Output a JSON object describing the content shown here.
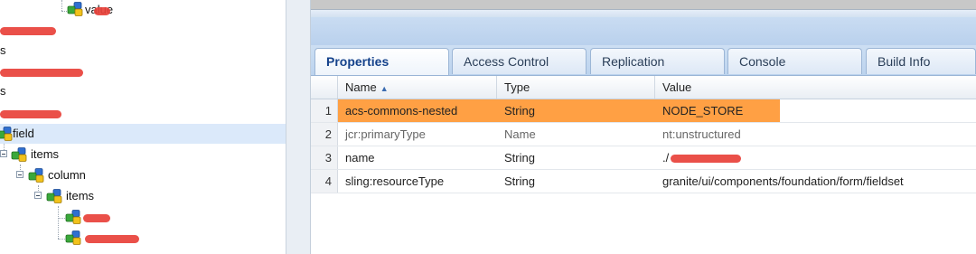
{
  "tree": {
    "nodes": [
      {
        "label": "value",
        "id": "value"
      },
      {
        "label": "s",
        "id": "s1"
      },
      {
        "label": "s",
        "id": "s2"
      },
      {
        "label": "field",
        "id": "field"
      },
      {
        "label": "items",
        "id": "items1"
      },
      {
        "label": "column",
        "id": "column"
      },
      {
        "label": "items",
        "id": "items2"
      }
    ]
  },
  "tabs": [
    {
      "label": "Properties",
      "active": true
    },
    {
      "label": "Access Control",
      "active": false
    },
    {
      "label": "Replication",
      "active": false
    },
    {
      "label": "Console",
      "active": false
    },
    {
      "label": "Build Info",
      "active": false
    }
  ],
  "grid": {
    "columns": [
      "Name",
      "Type",
      "Value"
    ],
    "rows": [
      {
        "num": "1",
        "name": "acs-commons-nested",
        "type": "String",
        "value": "NODE_STORE"
      },
      {
        "num": "2",
        "name": "jcr:primaryType",
        "type": "Name",
        "value": "nt:unstructured"
      },
      {
        "num": "3",
        "name": "name",
        "type": "String",
        "value": "./"
      },
      {
        "num": "4",
        "name": "sling:resourceType",
        "type": "String",
        "value": "granite/ui/components/foundation/form/fieldset"
      }
    ]
  },
  "colors": {
    "selected_row": "#ffa044",
    "tree_selection": "#dbe9fa",
    "redaction": "#e8413a",
    "tab_active_text": "#15428b"
  }
}
